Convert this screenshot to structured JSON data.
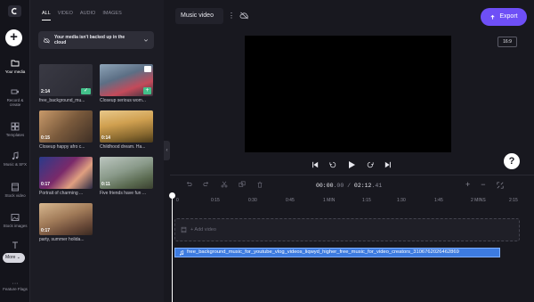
{
  "rail": {
    "items": [
      {
        "label": "Your media",
        "icon": "folder-icon"
      },
      {
        "label": "Record & create",
        "icon": "camera-icon"
      },
      {
        "label": "Templates",
        "icon": "templates-icon"
      },
      {
        "label": "Music & SFX",
        "icon": "music-note-icon"
      },
      {
        "label": "Stock video",
        "icon": "film-icon"
      },
      {
        "label": "Stock images",
        "icon": "image-icon"
      },
      {
        "label": "Text",
        "icon": "text-icon"
      },
      {
        "label": "Feature Flags",
        "icon": "dots-icon"
      }
    ],
    "more_label": "More"
  },
  "media": {
    "tabs": [
      "ALL",
      "VIDEO",
      "AUDIO",
      "IMAGES"
    ],
    "backup_text": "Your media isn't backed up in the cloud",
    "items": [
      {
        "label": "free_background_mu...",
        "duration": "2:14"
      },
      {
        "label": "Closeup serious wom...",
        "duration": ""
      },
      {
        "label": "Closeup happy afro c...",
        "duration": "0:15"
      },
      {
        "label": "Childhood dream. Ha...",
        "duration": "0:14"
      },
      {
        "label": "Portrait of charming ...",
        "duration": "0:17"
      },
      {
        "label": "Five friends have fun ...",
        "duration": "0:11"
      },
      {
        "label": "party, summer holida...",
        "duration": "0:17"
      }
    ]
  },
  "header": {
    "project_title": "Music video",
    "export_label": "Export"
  },
  "preview": {
    "aspect_ratio": "16:9"
  },
  "timeline": {
    "time_current": "00:00",
    "time_current_frac": ".00",
    "time_separator": " / ",
    "time_total": "02:12",
    "time_total_frac": ".41",
    "ruler_ticks": [
      "0",
      "0:15",
      "0:30",
      "0:45",
      "1 MIN",
      "1:15",
      "1:30",
      "1:45",
      "2 MINS",
      "2:15"
    ],
    "add_video_label": "+ Add video",
    "audio_clip_label": "free_background_music_for_youtube_vlog_videos_liqwyd_higher_free_music_for_video_creators_3106762026462869"
  },
  "colors": {
    "accent": "#6e4ff6",
    "audio_track": "#3d7be0",
    "success": "#43c08a"
  }
}
